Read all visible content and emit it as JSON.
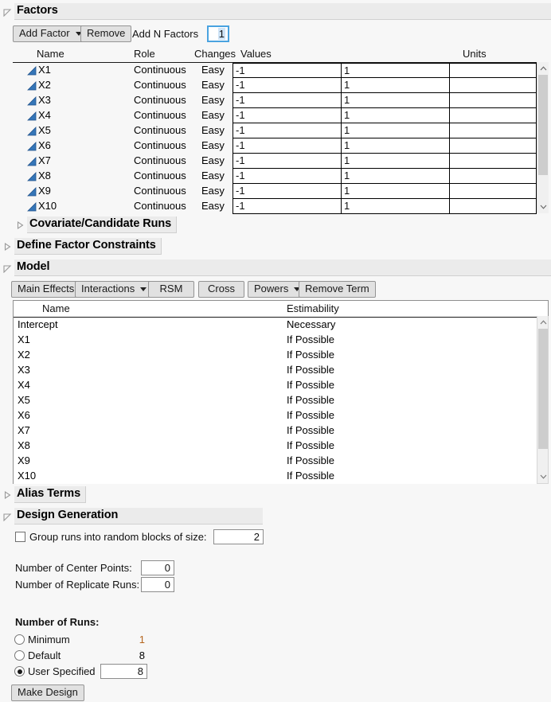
{
  "factors": {
    "title": "Factors",
    "toolbar": {
      "add_factor": "Add Factor",
      "remove": "Remove",
      "add_n_label": "Add N Factors",
      "add_n_value": "1"
    },
    "columns": [
      "Name",
      "Role",
      "Changes",
      "Values",
      "Units"
    ],
    "rows": [
      {
        "name": "X1",
        "role": "Continuous",
        "changes": "Easy",
        "low": "-1",
        "high": "1",
        "units": ""
      },
      {
        "name": "X2",
        "role": "Continuous",
        "changes": "Easy",
        "low": "-1",
        "high": "1",
        "units": ""
      },
      {
        "name": "X3",
        "role": "Continuous",
        "changes": "Easy",
        "low": "-1",
        "high": "1",
        "units": ""
      },
      {
        "name": "X4",
        "role": "Continuous",
        "changes": "Easy",
        "low": "-1",
        "high": "1",
        "units": ""
      },
      {
        "name": "X5",
        "role": "Continuous",
        "changes": "Easy",
        "low": "-1",
        "high": "1",
        "units": ""
      },
      {
        "name": "X6",
        "role": "Continuous",
        "changes": "Easy",
        "low": "-1",
        "high": "1",
        "units": ""
      },
      {
        "name": "X7",
        "role": "Continuous",
        "changes": "Easy",
        "low": "-1",
        "high": "1",
        "units": ""
      },
      {
        "name": "X8",
        "role": "Continuous",
        "changes": "Easy",
        "low": "-1",
        "high": "1",
        "units": ""
      },
      {
        "name": "X9",
        "role": "Continuous",
        "changes": "Easy",
        "low": "-1",
        "high": "1",
        "units": ""
      },
      {
        "name": "X10",
        "role": "Continuous",
        "changes": "Easy",
        "low": "-1",
        "high": "1",
        "units": ""
      }
    ]
  },
  "covariate_section": {
    "title": "Covariate/Candidate Runs"
  },
  "constraints_section": {
    "title": "Define Factor Constraints"
  },
  "model": {
    "title": "Model",
    "toolbar": {
      "main_effects": "Main Effects",
      "interactions": "Interactions",
      "rsm": "RSM",
      "cross": "Cross",
      "powers": "Powers",
      "remove_term": "Remove Term"
    },
    "columns": [
      "Name",
      "Estimability"
    ],
    "rows": [
      {
        "name": "Intercept",
        "estimability": "Necessary"
      },
      {
        "name": "X1",
        "estimability": "If Possible"
      },
      {
        "name": "X2",
        "estimability": "If Possible"
      },
      {
        "name": "X3",
        "estimability": "If Possible"
      },
      {
        "name": "X4",
        "estimability": "If Possible"
      },
      {
        "name": "X5",
        "estimability": "If Possible"
      },
      {
        "name": "X6",
        "estimability": "If Possible"
      },
      {
        "name": "X7",
        "estimability": "If Possible"
      },
      {
        "name": "X8",
        "estimability": "If Possible"
      },
      {
        "name": "X9",
        "estimability": "If Possible"
      },
      {
        "name": "X10",
        "estimability": "If Possible"
      }
    ]
  },
  "alias_section": {
    "title": "Alias Terms"
  },
  "design_generation": {
    "title": "Design Generation",
    "group_blocks_label": "Group runs into random blocks of size:",
    "group_blocks_value": "2",
    "group_blocks_checked": false,
    "center_points_label": "Number of Center Points:",
    "center_points_value": "0",
    "replicate_runs_label": "Number of Replicate Runs:",
    "replicate_runs_value": "0",
    "runs_title": "Number of Runs:",
    "runs_options": [
      {
        "label": "Minimum",
        "value": "1",
        "selected": false
      },
      {
        "label": "Default",
        "value": "8",
        "selected": false
      },
      {
        "label": "User Specified",
        "value": "8",
        "selected": true
      }
    ],
    "make_design": "Make Design"
  },
  "colors": {
    "accent": "#4aa3e0",
    "factor_icon": "#2b6fb5",
    "panel": "#ebebeb",
    "background": "#f7f7f7",
    "minimum_value": "#b5651d"
  }
}
